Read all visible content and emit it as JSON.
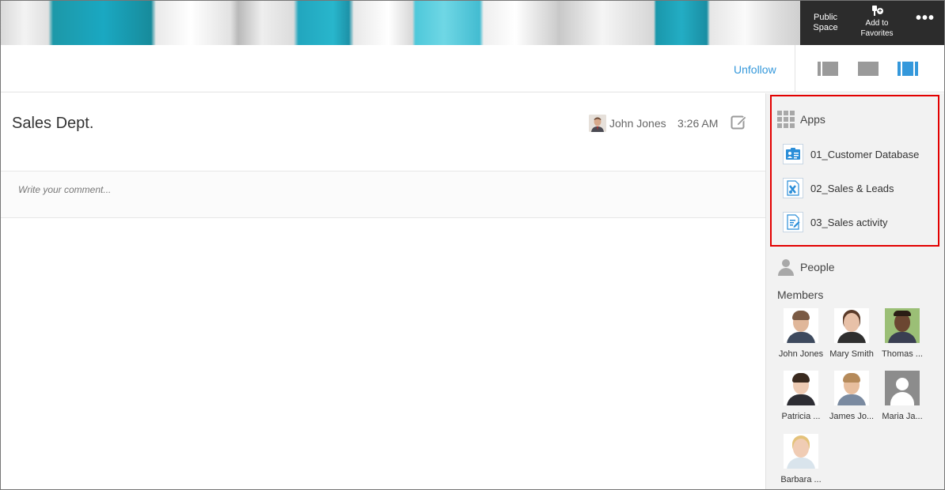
{
  "banner": {
    "public_space": "Public Space",
    "add_to_favorites": "Add to Favorites",
    "more": "•••"
  },
  "toolbar": {
    "unfollow": "Unfollow"
  },
  "thread": {
    "title": "Sales Dept.",
    "author": "John Jones",
    "time": "3:26 AM",
    "comment_placeholder": "Write your comment..."
  },
  "sidebar": {
    "apps_title": "Apps",
    "apps": [
      {
        "label": "01_Customer Database",
        "icon": "customer-database-icon"
      },
      {
        "label": "02_Sales & Leads",
        "icon": "sales-leads-icon"
      },
      {
        "label": "03_Sales activity",
        "icon": "sales-activity-icon"
      }
    ],
    "people_title": "People",
    "members_label": "Members",
    "members": [
      {
        "name": "John Jones"
      },
      {
        "name": "Mary Smith"
      },
      {
        "name": "Thomas ..."
      },
      {
        "name": "Patricia ..."
      },
      {
        "name": "James Jo..."
      },
      {
        "name": "Maria Ja..."
      },
      {
        "name": "Barbara ..."
      }
    ]
  },
  "colors": {
    "accent": "#3498db",
    "highlight_border": "#e30000",
    "sidebar_bg": "#f2f2f2"
  }
}
